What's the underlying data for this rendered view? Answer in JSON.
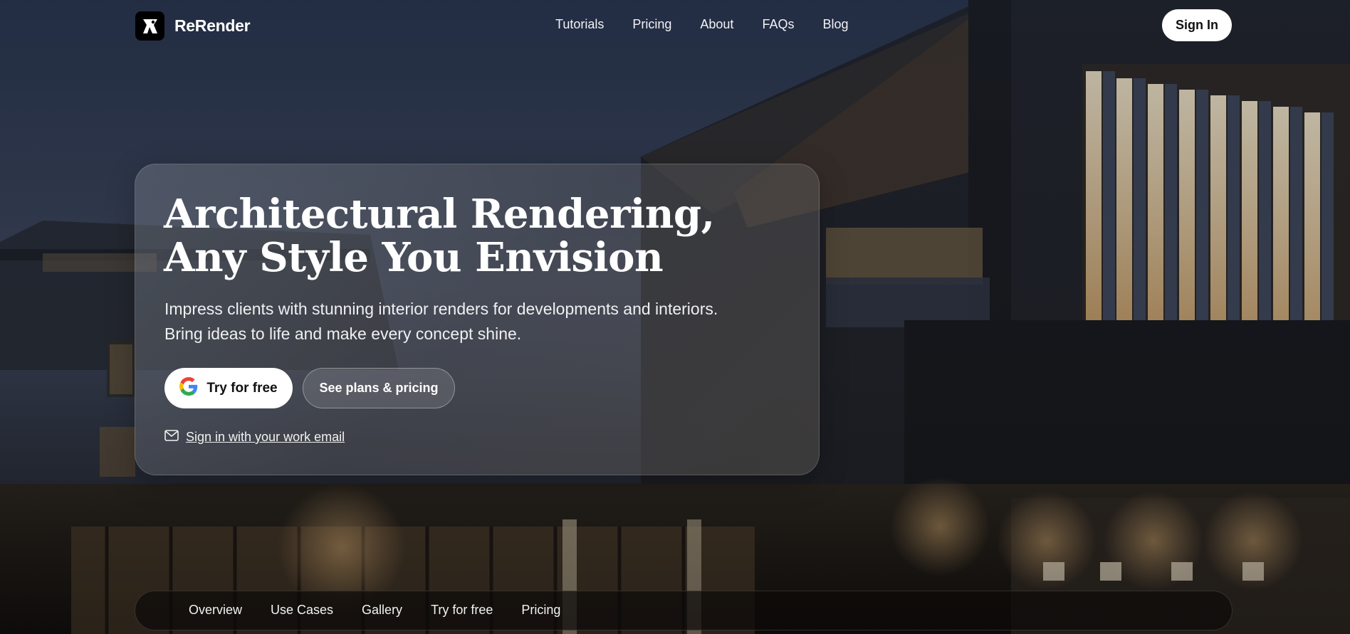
{
  "brand": {
    "name": "ReRender",
    "logo_icon": "rerender-logo-icon"
  },
  "topnav": {
    "links": [
      "Tutorials",
      "Pricing",
      "About",
      "FAQs",
      "Blog"
    ],
    "signin_label": "Sign In"
  },
  "hero": {
    "title_line1": "Architectural Rendering,",
    "title_line2": "Any Style You Envision",
    "subtitle_line1": "Impress clients with stunning interior renders for developments and interiors.",
    "subtitle_line2": "Bring ideas to life and make every concept shine.",
    "try_label": "Try for free",
    "try_icon": "google-icon",
    "plans_label": "See plans & pricing",
    "email_label": "Sign in with your work email",
    "email_icon": "mail-icon"
  },
  "subnav": {
    "links": [
      "Overview",
      "Use Cases",
      "Gallery",
      "Try for free",
      "Pricing"
    ]
  }
}
